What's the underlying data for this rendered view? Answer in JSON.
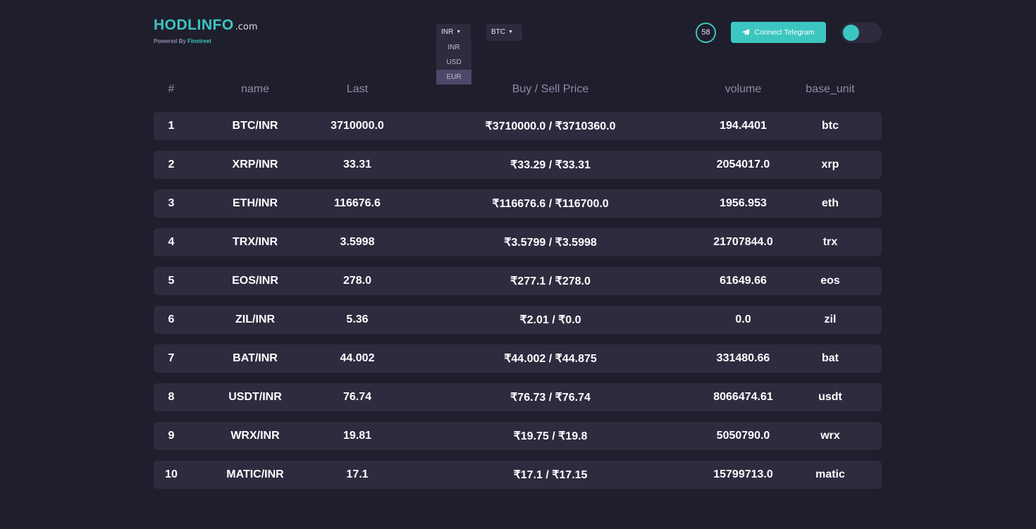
{
  "header": {
    "logo_main": "HODLINFO",
    "logo_domain": ".com",
    "powered_by": "Powered By",
    "powered_brand": "Finstreet",
    "currency_selected": "INR",
    "currency_options": [
      "INR",
      "USD",
      "EUR"
    ],
    "currency_highlighted": "EUR",
    "coin_selected": "BTC",
    "timer": "58",
    "telegram_label": "Connect Telegram",
    "accent_color": "#3dc6c1",
    "background_color": "#1f1e2d"
  },
  "table": {
    "headers": [
      "#",
      "name",
      "Last",
      "Buy / Sell Price",
      "volume",
      "base_unit"
    ],
    "rows": [
      {
        "idx": "1",
        "name": "BTC/INR",
        "last": "3710000.0",
        "price": "₹3710000.0 / ₹3710360.0",
        "volume": "194.4401",
        "base": "btc"
      },
      {
        "idx": "2",
        "name": "XRP/INR",
        "last": "33.31",
        "price": "₹33.29 / ₹33.31",
        "volume": "2054017.0",
        "base": "xrp"
      },
      {
        "idx": "3",
        "name": "ETH/INR",
        "last": "116676.6",
        "price": "₹116676.6 / ₹116700.0",
        "volume": "1956.953",
        "base": "eth"
      },
      {
        "idx": "4",
        "name": "TRX/INR",
        "last": "3.5998",
        "price": "₹3.5799 / ₹3.5998",
        "volume": "21707844.0",
        "base": "trx"
      },
      {
        "idx": "5",
        "name": "EOS/INR",
        "last": "278.0",
        "price": "₹277.1 / ₹278.0",
        "volume": "61649.66",
        "base": "eos"
      },
      {
        "idx": "6",
        "name": "ZIL/INR",
        "last": "5.36",
        "price": "₹2.01 / ₹0.0",
        "volume": "0.0",
        "base": "zil"
      },
      {
        "idx": "7",
        "name": "BAT/INR",
        "last": "44.002",
        "price": "₹44.002 / ₹44.875",
        "volume": "331480.66",
        "base": "bat"
      },
      {
        "idx": "8",
        "name": "USDT/INR",
        "last": "76.74",
        "price": "₹76.73 / ₹76.74",
        "volume": "8066474.61",
        "base": "usdt"
      },
      {
        "idx": "9",
        "name": "WRX/INR",
        "last": "19.81",
        "price": "₹19.75 / ₹19.8",
        "volume": "5050790.0",
        "base": "wrx"
      },
      {
        "idx": "10",
        "name": "MATIC/INR",
        "last": "17.1",
        "price": "₹17.1 / ₹17.15",
        "volume": "15799713.0",
        "base": "matic"
      }
    ]
  }
}
